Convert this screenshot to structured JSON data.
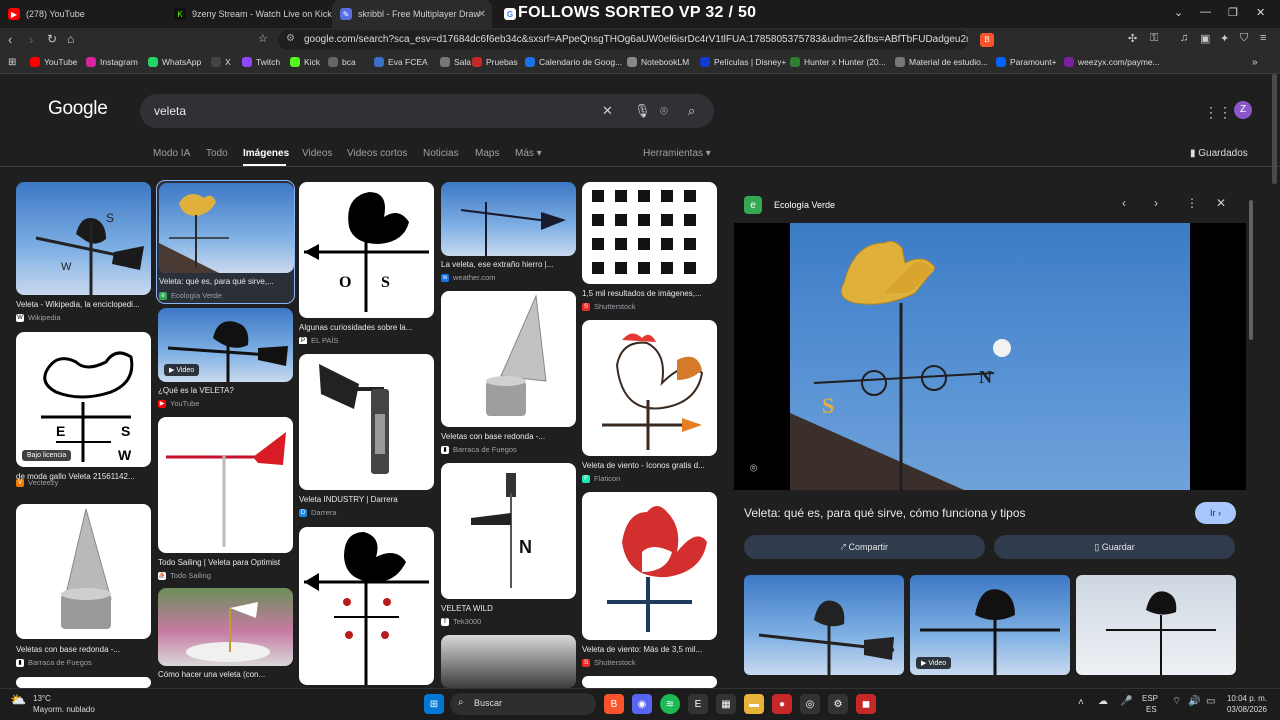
{
  "overlay_title": "FOLLOWS SORTEO VP 32 / 50",
  "tabs": [
    {
      "label": "(278) YouTube",
      "color": "#ff0000",
      "glyph": "▶"
    },
    {
      "label": "9zeny Stream - Watch Live on Kick",
      "color": "#53fc18",
      "glyph": "K"
    },
    {
      "label": "skribbl - Free Multiplayer Drawing",
      "color": "#5b6ee1",
      "glyph": "✎"
    },
    {
      "label": "veleta - Buscar con Google",
      "color": "#ffffff",
      "glyph": "G"
    }
  ],
  "address": {
    "url": "google.com/search?sca_esv=d17684dc6f6eb34c&sxsrf=APpeQnsgTHOg6aUW0el6isrDc4rV1tlFUA:1785805375783&udm=2&fbs=ABfTbFUDadgeu2mn4mYJ8iE..."
  },
  "bookmarks": [
    {
      "label": "YouTube",
      "color": "#ff0000"
    },
    {
      "label": "Instagram",
      "color": "#d6249f"
    },
    {
      "label": "WhatsApp",
      "color": "#25d366"
    },
    {
      "label": "X",
      "color": "#444444"
    },
    {
      "label": "Twitch",
      "color": "#9146ff"
    },
    {
      "label": "Kick",
      "color": "#53fc18"
    },
    {
      "label": "bca",
      "color": "#666666"
    },
    {
      "label": "Eva FCEA",
      "color": "#3b6fc4"
    },
    {
      "label": "Sala 9",
      "color": "#777777"
    },
    {
      "label": "Pruebas",
      "color": "#c62828"
    },
    {
      "label": "Calendario de Goog...",
      "color": "#1a73e8"
    },
    {
      "label": "NotebookLM",
      "color": "#888888"
    },
    {
      "label": "Películas | Disney+",
      "color": "#113ccf"
    },
    {
      "label": "Hunter x Hunter (20...",
      "color": "#2e7d32"
    },
    {
      "label": "Material de estudio...",
      "color": "#777777"
    },
    {
      "label": "Paramount+",
      "color": "#0064ff"
    },
    {
      "label": "weezyx.com/payme...",
      "color": "#7b1fa2"
    }
  ],
  "google": {
    "logo": "Google",
    "query": "veleta",
    "filters": [
      "Modo IA",
      "Todo",
      "Imágenes",
      "Videos",
      "Videos cortos",
      "Noticias",
      "Maps",
      "Más ▾"
    ],
    "tools": "Herramientas ▾",
    "saved": "Guardados",
    "avatar": "Z"
  },
  "results": [
    {
      "caption": "Veleta - Wikipedia, la enciclopedi...",
      "source": "Wikipedia",
      "src_color": "#ffffff"
    },
    {
      "caption": "Veleta: qué es, para qué sirve,...",
      "source": "Ecología Verde",
      "src_color": "#34a853"
    },
    {
      "caption": "Algunas curiosidades sobre la...",
      "source": "EL PAÍS",
      "src_color": "#ffffff"
    },
    {
      "caption": "La veleta, ese extraño hierro |...",
      "source": "weather.com",
      "src_color": "#1a73e8"
    },
    {
      "caption": "1,5 mil resultados de imágenes,...",
      "source": "Shutterstock",
      "src_color": "#ee2b24"
    },
    {
      "caption": "de moda gallo Veleta 21561142...",
      "source": "Vecteezy",
      "src_color": "#f57c00",
      "badge": "Bajo licencia"
    },
    {
      "caption": "¿Qué es la VELETA?",
      "source": "YouTube",
      "src_color": "#ff0000",
      "badge": "▶ Video"
    },
    {
      "caption": "Veleta INDUSTRY | Darrera",
      "source": "Darrera",
      "src_color": "#1e88e5"
    },
    {
      "caption": "Veletas con base redonda -...",
      "source": "Barraca de Fuegos",
      "src_color": "#ffffff"
    },
    {
      "caption": "Veleta de viento - Iconos gratis d...",
      "source": "Flaticon",
      "src_color": "#1de9b6"
    },
    {
      "caption": "Todo Sailing | Veleta para Optimist",
      "source": "Todo Sailing",
      "src_color": "#ffffff"
    },
    {
      "caption": "Veletas con base redonda -...",
      "source": "Barraca de Fuegos",
      "src_color": "#ffffff"
    },
    {
      "caption": "VELETA WILD",
      "source": "Tek3000",
      "src_color": "#ffffff"
    },
    {
      "caption": "Veleta de viento: Más de 3,5 mil...",
      "source": "Shutterstock",
      "src_color": "#ee2b24"
    },
    {
      "caption": "Cómo hacer una veleta (con...",
      "source": "wikiHow",
      "src_color": "#9ccc65"
    }
  ],
  "panel": {
    "source": "Ecología Verde",
    "title": "Veleta: qué es, para qué sirve, cómo funciona y tipos",
    "visit": "Ir ›",
    "share": "⤤ Compartir",
    "save": "▯ Guardar",
    "thumb_video": "▶ Video"
  },
  "taskbar": {
    "weather_temp": "13°C",
    "weather_desc": "Mayorm. nublado",
    "search": "Buscar",
    "lang": "ESP",
    "lang2": "ES",
    "time": "10:04 p. m.",
    "date": "03/08/2026"
  },
  "colors": {
    "accent": "#a8c7fa",
    "sky": "#5a93d4",
    "gold": "#e0b13a"
  }
}
